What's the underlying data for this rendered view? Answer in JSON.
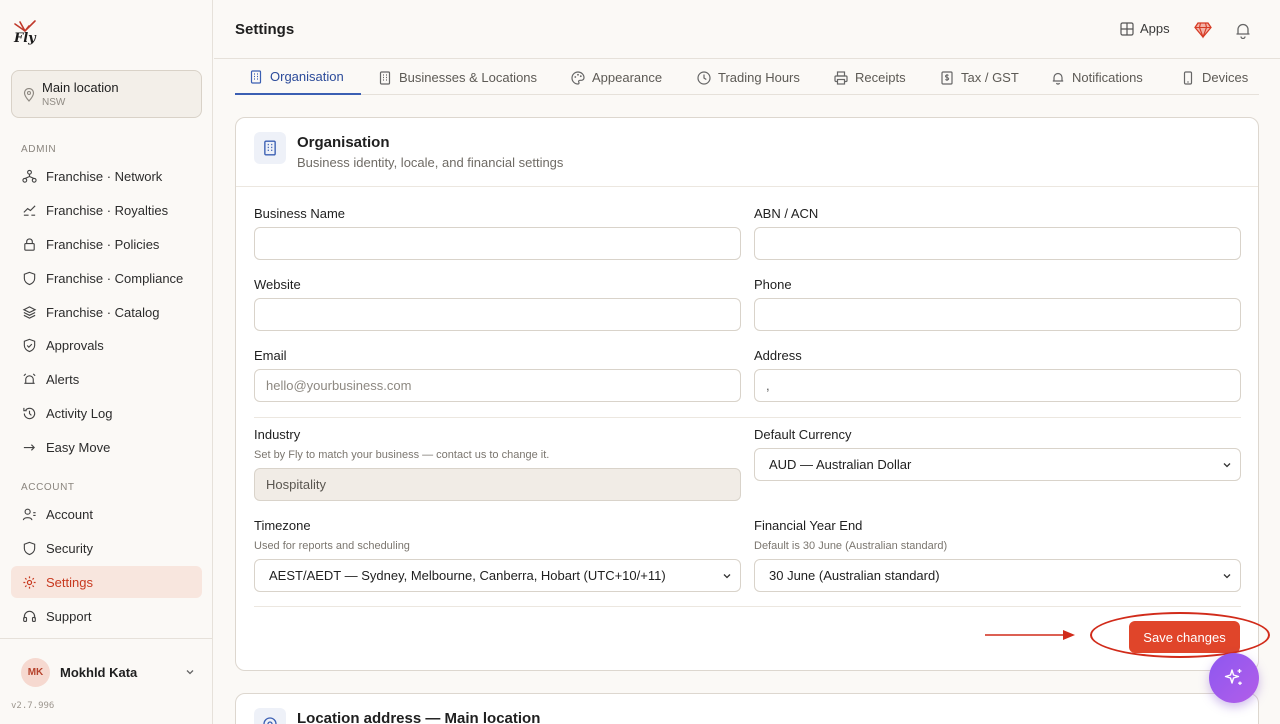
{
  "sidebar": {
    "logo_text": "Fly",
    "location": {
      "name": "Main location",
      "region": "NSW"
    },
    "admin_label": "ADMIN",
    "admin_items": [
      {
        "label": "Franchise · Network",
        "icon": "network-icon"
      },
      {
        "label": "Franchise · Royalties",
        "icon": "royalties-icon"
      },
      {
        "label": "Franchise · Policies",
        "icon": "lock-icon"
      },
      {
        "label": "Franchise · Compliance",
        "icon": "shield-icon"
      },
      {
        "label": "Franchise · Catalog",
        "icon": "layers-icon"
      },
      {
        "label": "Approvals",
        "icon": "shield-check-icon"
      },
      {
        "label": "Alerts",
        "icon": "alarm-icon"
      },
      {
        "label": "Activity Log",
        "icon": "history-icon"
      },
      {
        "label": "Easy Move",
        "icon": "arrow-right-icon"
      }
    ],
    "account_label": "ACCOUNT",
    "account_items": [
      {
        "label": "Account",
        "icon": "user-icon"
      },
      {
        "label": "Security",
        "icon": "shield-icon"
      },
      {
        "label": "Settings",
        "icon": "gear-icon",
        "active": true
      },
      {
        "label": "Support",
        "icon": "headset-icon"
      }
    ],
    "user": {
      "initials": "MK",
      "name": "Mokhld Kata"
    },
    "version": "v2.7.996"
  },
  "header": {
    "title": "Settings",
    "apps_label": "Apps"
  },
  "tabs": [
    {
      "label": "Organisation",
      "active": true
    },
    {
      "label": "Businesses & Locations"
    },
    {
      "label": "Appearance"
    },
    {
      "label": "Trading Hours"
    },
    {
      "label": "Receipts"
    },
    {
      "label": "Tax / GST"
    },
    {
      "label": "Notifications"
    },
    {
      "label": "Devices"
    }
  ],
  "card": {
    "title": "Organisation",
    "subtitle": "Business identity, locale, and financial settings",
    "fields": {
      "business_name": {
        "label": "Business Name",
        "value": ""
      },
      "abn": {
        "label": "ABN / ACN",
        "value": ""
      },
      "website": {
        "label": "Website",
        "value": ""
      },
      "phone": {
        "label": "Phone",
        "value": ""
      },
      "email": {
        "label": "Email",
        "placeholder": "hello@yourbusiness.com"
      },
      "address": {
        "label": "Address",
        "value": ","
      },
      "industry": {
        "label": "Industry",
        "help": "Set by Fly to match your business — contact us to change it.",
        "value": "Hospitality"
      },
      "currency": {
        "label": "Default Currency",
        "value": "AUD — Australian Dollar"
      },
      "timezone": {
        "label": "Timezone",
        "help": "Used for reports and scheduling",
        "value": "AEST/AEDT — Sydney, Melbourne, Canberra, Hobart (UTC+10/+11)"
      },
      "fy_end": {
        "label": "Financial Year End",
        "help": "Default is 30 June (Australian standard)",
        "value": "30 June (Australian standard)"
      }
    },
    "save_label": "Save changes"
  },
  "card2": {
    "title": "Location address — Main location"
  },
  "colors": {
    "accent": "#e0452a",
    "tab_active": "#3b5fb3",
    "fab": "#9a5aee"
  }
}
